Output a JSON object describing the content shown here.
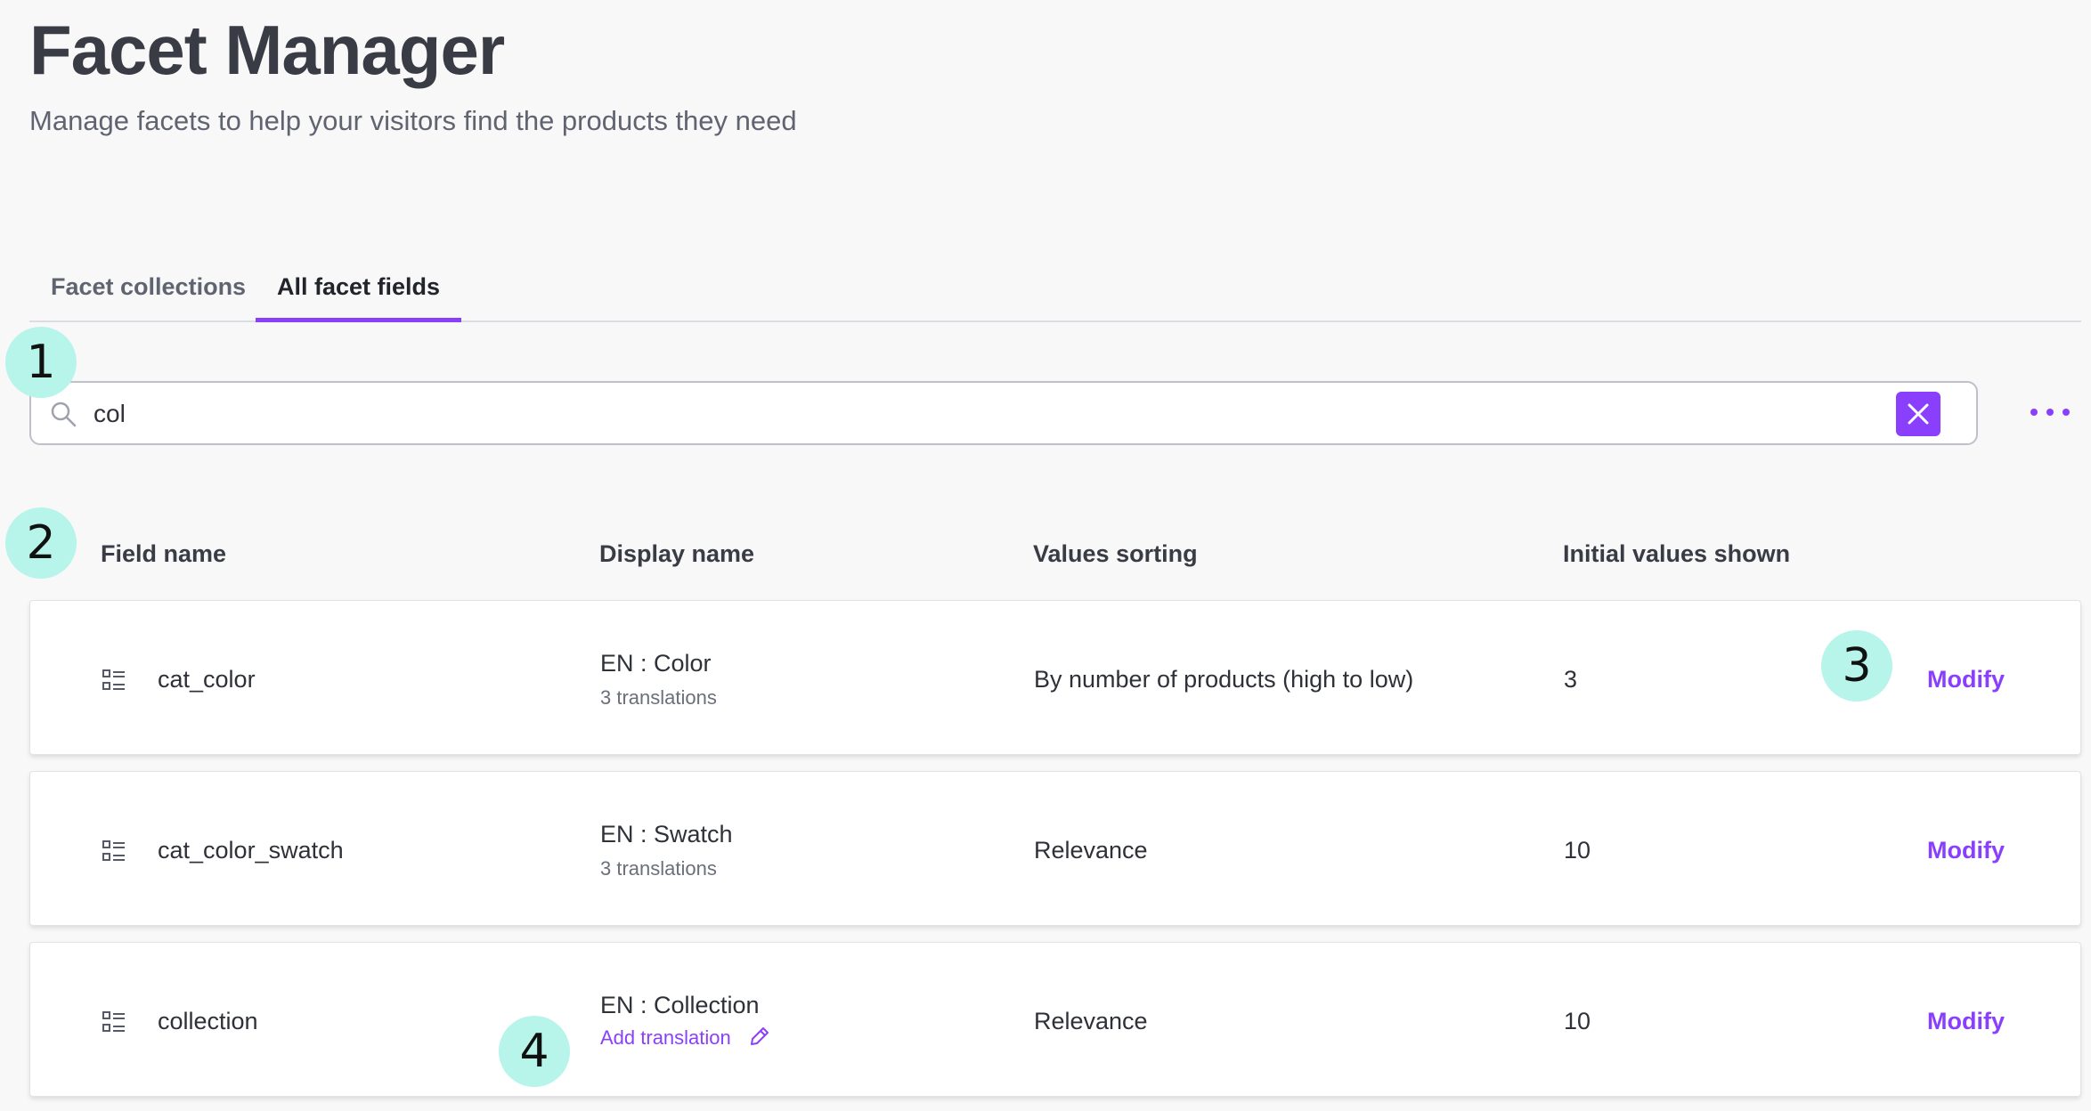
{
  "page": {
    "title": "Facet Manager",
    "subtitle": "Manage facets to help your visitors find the products they need"
  },
  "tabs": [
    {
      "label": "Facet collections",
      "active": false
    },
    {
      "label": "All facet fields",
      "active": true
    }
  ],
  "search": {
    "value": "col",
    "icon": "search-icon",
    "clear_icon": "close-icon"
  },
  "more_icon": "more-horizontal-icon",
  "accent_color": "#8a3ffc",
  "table": {
    "headers": [
      "Field name",
      "Display name",
      "Values sorting",
      "Initial values shown"
    ],
    "rows": [
      {
        "field": "cat_color",
        "display": "EN : Color",
        "translations": "3 translations",
        "sorting": "By number of products (high to low)",
        "initial": "3",
        "action": "Modify"
      },
      {
        "field": "cat_color_swatch",
        "display": "EN : Swatch",
        "translations": "3 translations",
        "sorting": "Relevance",
        "initial": "10",
        "action": "Modify"
      },
      {
        "field": "collection",
        "display": "EN : Collection",
        "add_translation": "Add translation",
        "sorting": "Relevance",
        "initial": "10",
        "action": "Modify"
      }
    ]
  },
  "callouts": [
    "1",
    "2",
    "3",
    "4"
  ]
}
